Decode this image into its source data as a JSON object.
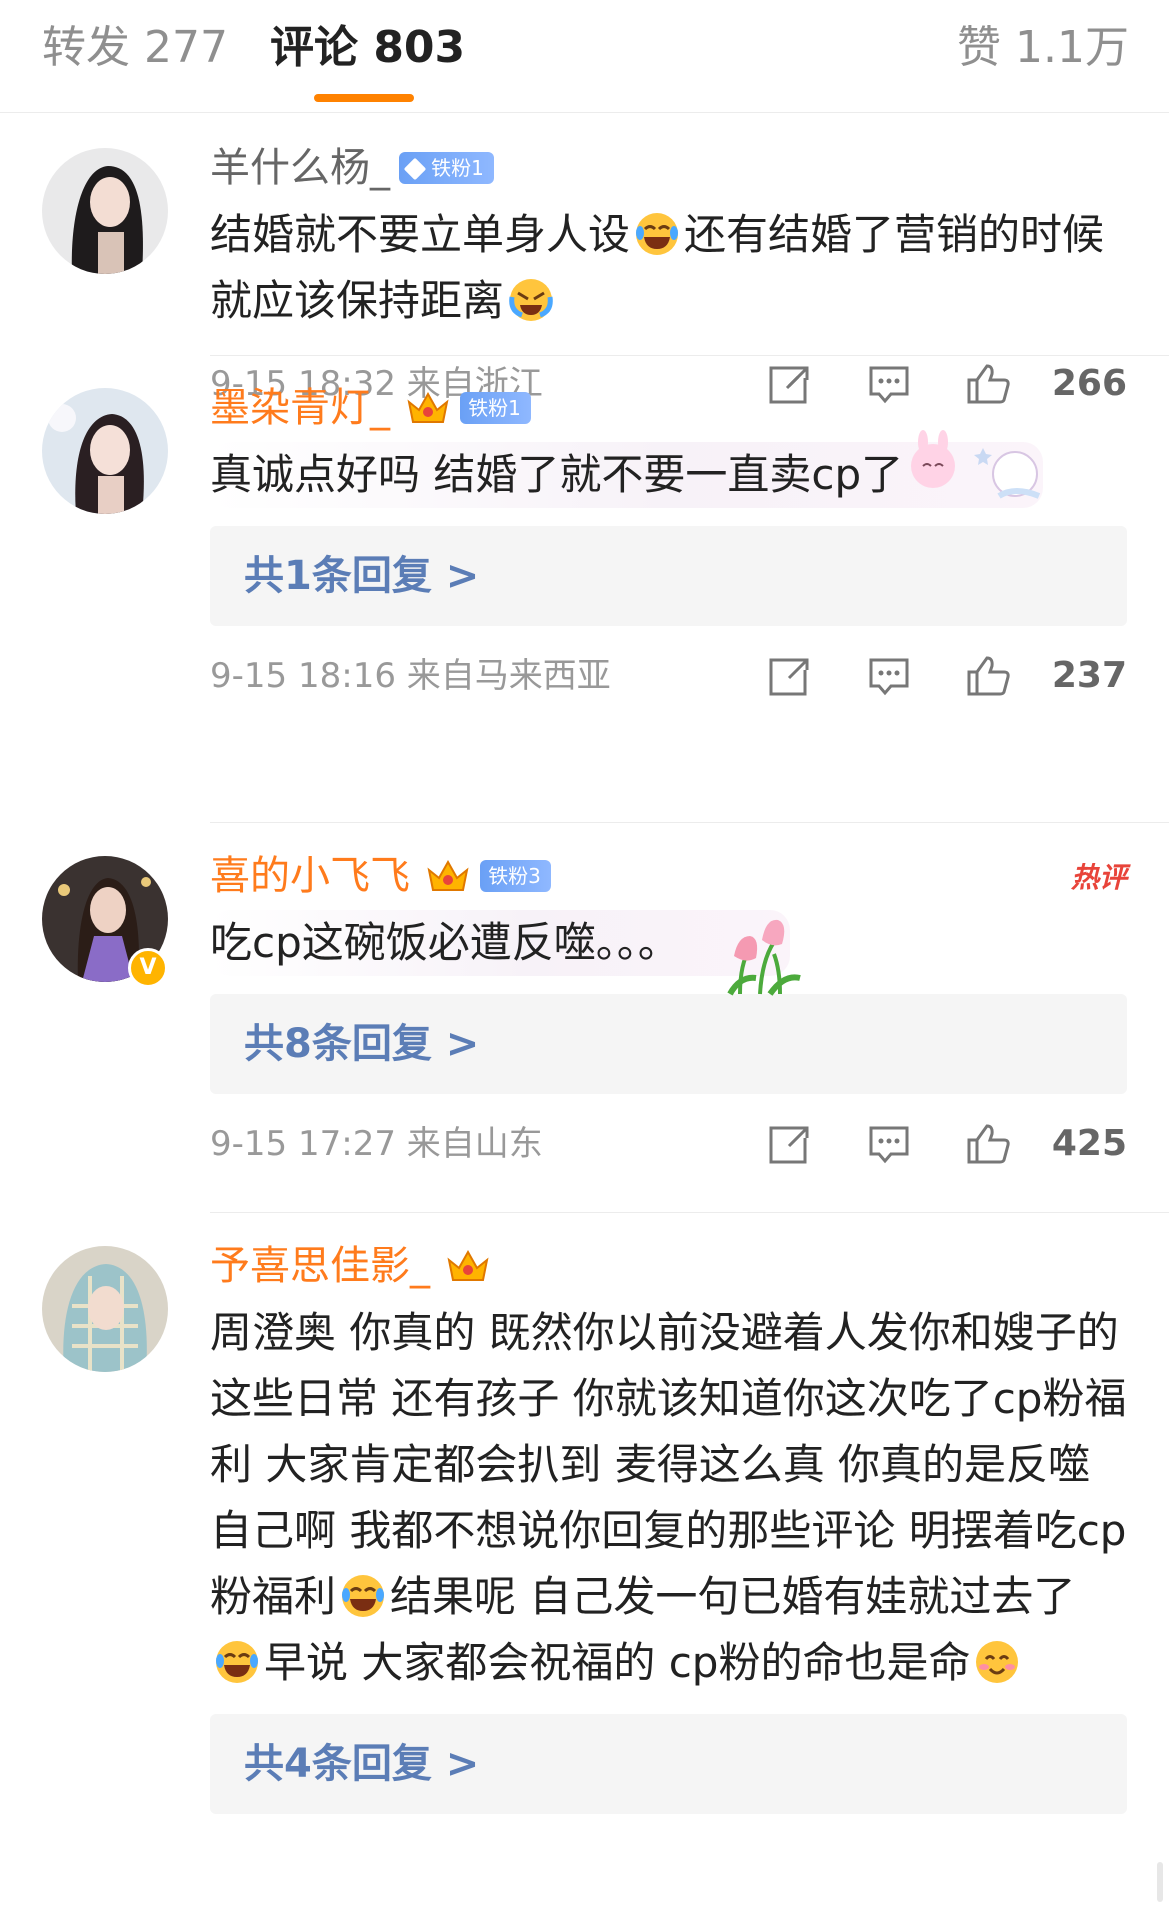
{
  "tabs": {
    "repost": "转发 277",
    "comment": "评论 803",
    "like": "赞 1.1万"
  },
  "colors": {
    "accent": "#ff8200",
    "vip_name": "#ff7b1c",
    "link": "#5b7db6",
    "hot": "#e8443a"
  },
  "comments": [
    {
      "username": "羊什么杨_",
      "fan_badge": "铁粉1",
      "text_parts": [
        "结婚就不要立单身人设",
        "还有结婚了营销的时候就应该保持距离"
      ],
      "emoji": [
        "laughing-tears-emoji",
        "crying-laughing-emoji"
      ],
      "time_location": "9-15 18:32  来自浙江",
      "likes": "266"
    },
    {
      "username": "墨染青灯_",
      "fan_badge": "铁粉1",
      "text": "真诚点好吗  结婚了就不要一直卖cp了",
      "reply": "共1条回复 >",
      "time_location": "9-15 18:16  来自马来西亚",
      "likes": "237"
    },
    {
      "username": "喜的小飞飞",
      "fan_badge": "铁粉3",
      "hot_badge": "热评",
      "text": "吃cp这碗饭必遭反噬。。。",
      "reply": "共8条回复 >",
      "time_location": "9-15 17:27  来自山东",
      "likes": "425"
    },
    {
      "username": "予喜思佳影_",
      "text_parts": [
        "周澄奥 你真的 既然你以前没避着人发你和嫂子的这些日常 还有孩子 你就该知道你这次吃了cp粉福利 大家肯定都会扒到 麦得这么真 你真的是反噬自己啊 我都不想说你回复的那些评论 明摆着吃cp粉福利",
        "结果呢 自己发一句已婚有娃就过去了",
        "早说 大家都会祝福的 cp粉的命也是命"
      ],
      "reply": "共4条回复 >"
    }
  ]
}
